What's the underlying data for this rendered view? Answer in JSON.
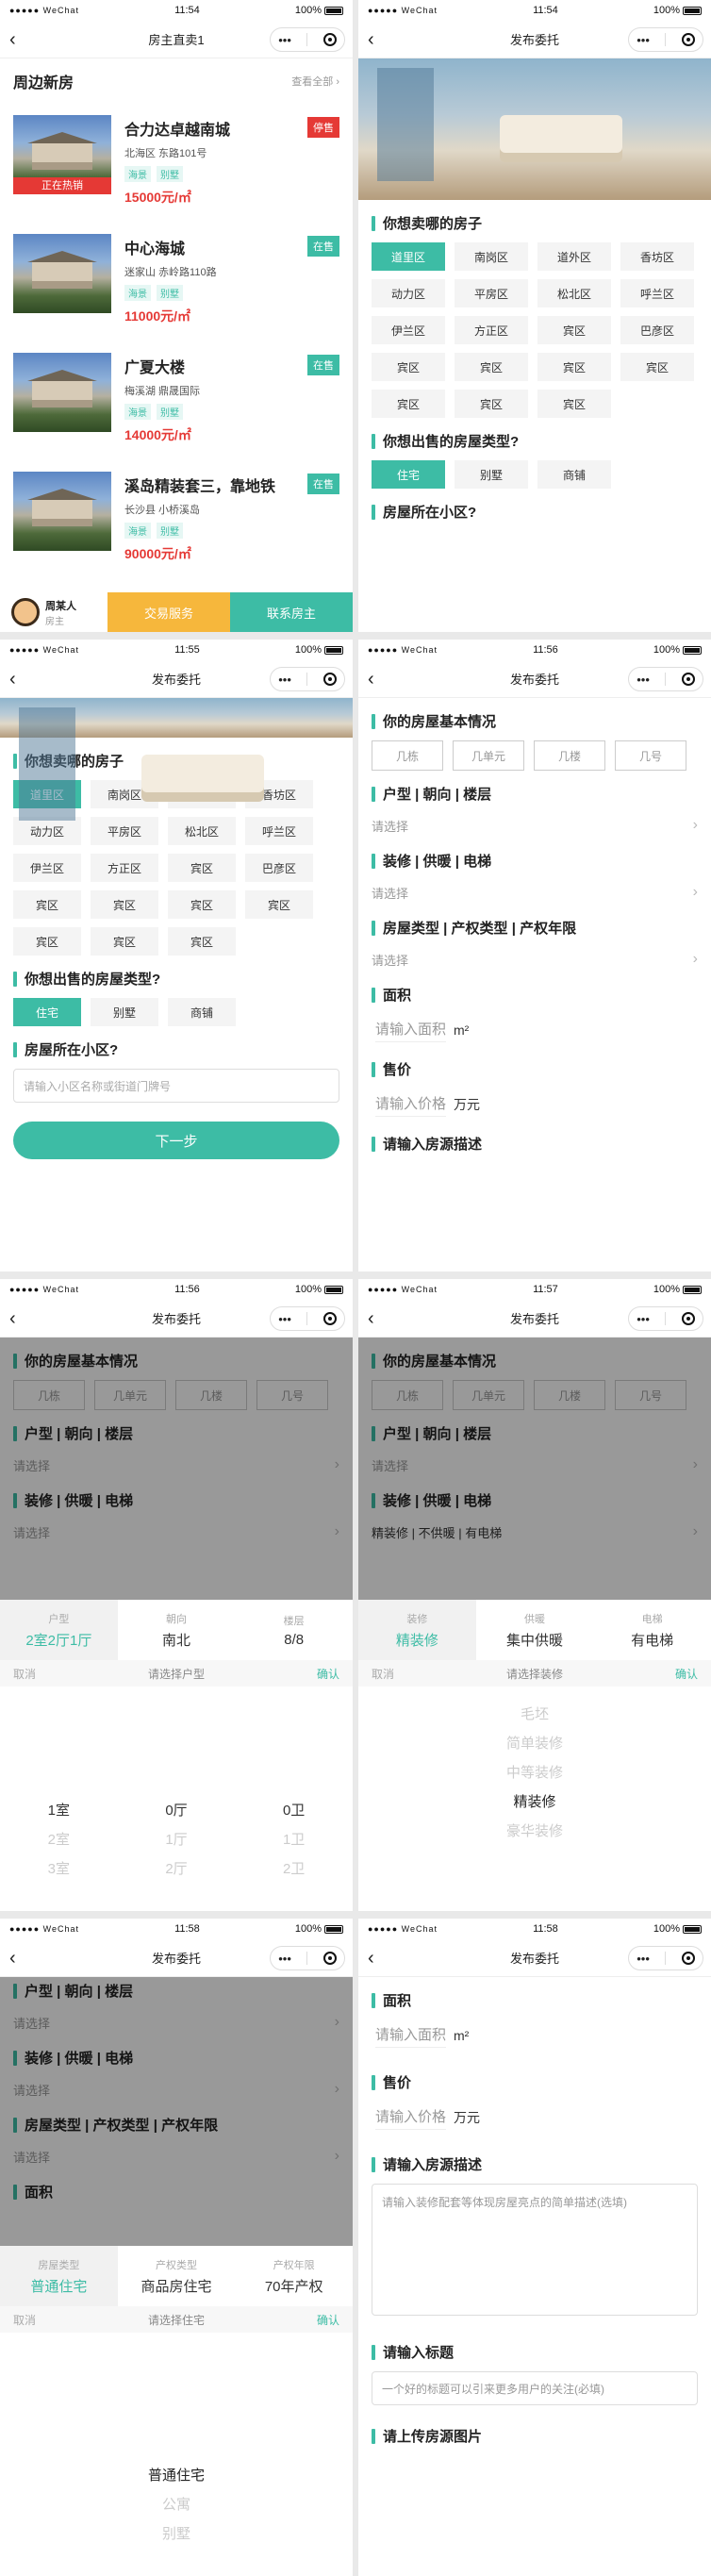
{
  "status": {
    "signal": "●●●●● WeChat",
    "battery": "100%"
  },
  "capsule": {
    "more": "•••"
  },
  "p1": {
    "time": "11:54",
    "nav_title": "房主直卖1",
    "section_title": "周边新房",
    "more": "查看全部",
    "houses": [
      {
        "name": "合力达卓越南城",
        "addr": "北海区 东路101号",
        "tags": [
          "海景",
          "别墅"
        ],
        "price": "15000元/㎡",
        "badge": "停售",
        "badge_color": "red",
        "hot": "正在热销"
      },
      {
        "name": "中心海城",
        "addr": "迷家山 赤岭路110路",
        "tags": [
          "海景",
          "别墅"
        ],
        "price": "11000元/㎡",
        "badge": "在售",
        "badge_color": "green",
        "hot": ""
      },
      {
        "name": "广夏大楼",
        "addr": "梅溪湖 鼎晟国际",
        "tags": [
          "海景",
          "别墅"
        ],
        "price": "14000元/㎡",
        "badge": "在售",
        "badge_color": "green",
        "hot": ""
      },
      {
        "name": "溪岛精装套三，靠地铁",
        "addr": "长沙县 小桥溪岛",
        "tags": [
          "海景",
          "别墅"
        ],
        "price": "90000元/㎡",
        "badge": "在售",
        "badge_color": "green",
        "hot": ""
      }
    ],
    "agent_name": "周某人",
    "agent_role": "房主",
    "btn_trade": "交易服务",
    "btn_contact": "联系房主"
  },
  "p2": {
    "time": "11:54",
    "nav_title": "发布委托",
    "sell_title": "你想卖哪的房子",
    "districts": [
      "道里区",
      "南岗区",
      "道外区",
      "香坊区",
      "动力区",
      "平房区",
      "松北区",
      "呼兰区",
      "伊兰区",
      "方正区",
      "宾区",
      "巴彦区",
      "宾区",
      "宾区",
      "宾区",
      "宾区",
      "宾区",
      "宾区",
      "宾区"
    ],
    "type_title": "你想出售的房屋类型?",
    "types": [
      "住宅",
      "别墅",
      "商铺"
    ],
    "community_title": "房屋所在小区?"
  },
  "p3": {
    "time": "11:55",
    "nav_title": "发布委托",
    "community_placeholder": "请输入小区名称或街道门牌号",
    "next": "下一步"
  },
  "p4": {
    "time": "11:56",
    "nav_title": "发布委托",
    "basic_title": "你的房屋基本情况",
    "boxes": [
      "几栋",
      "几单元",
      "几楼",
      "几号"
    ],
    "layout_title": "户型 | 朝向 | 楼层",
    "select": "请选择",
    "deco_title": "装修 | 供暖 | 电梯",
    "prop_title": "房屋类型 | 产权类型 | 产权年限",
    "area_title": "面积",
    "area_ph": "请输入面积",
    "area_unit": "m²",
    "price_title": "售价",
    "price_ph": "请输入价格",
    "price_unit": "万元",
    "desc_title": "请输入房源描述"
  },
  "p5": {
    "time": "11:56",
    "tabs": [
      {
        "k": "户型",
        "v": "2室2厅1厅"
      },
      {
        "k": "朝向",
        "v": "南北"
      },
      {
        "k": "楼层",
        "v": "8/8"
      }
    ],
    "cancel": "取消",
    "title": "请选择户型",
    "ok": "确认",
    "cols": [
      [
        "1室",
        "2室",
        "3室"
      ],
      [
        "0厅",
        "1厅",
        "2厅"
      ],
      [
        "0卫",
        "1卫",
        "2卫"
      ]
    ]
  },
  "p6": {
    "time": "11:57",
    "deco_value": "精装修 | 不供暖 | 有电梯",
    "tabs": [
      {
        "k": "装修",
        "v": "精装修"
      },
      {
        "k": "供暖",
        "v": "集中供暖"
      },
      {
        "k": "电梯",
        "v": "有电梯"
      }
    ],
    "cancel": "取消",
    "title": "请选择装修",
    "ok": "确认",
    "options": [
      "毛坯",
      "简单装修",
      "中等装修",
      "精装修",
      "豪华装修"
    ]
  },
  "p7": {
    "time": "11:58",
    "tabs": [
      {
        "k": "房屋类型",
        "v": "普通住宅"
      },
      {
        "k": "产权类型",
        "v": "商品房住宅"
      },
      {
        "k": "产权年限",
        "v": "70年产权"
      }
    ],
    "cancel": "取消",
    "title": "请选择住宅",
    "ok": "确认",
    "options": [
      "普通住宅",
      "公寓",
      "别墅"
    ]
  },
  "p8": {
    "time": "11:58",
    "desc_ph": "请输入装修配套等体现房屋亮点的简单描述(选填)",
    "title_title": "请输入标题",
    "title_ph": "一个好的标题可以引来更多用户的关注(必填)",
    "photo_title": "请上传房源图片"
  }
}
